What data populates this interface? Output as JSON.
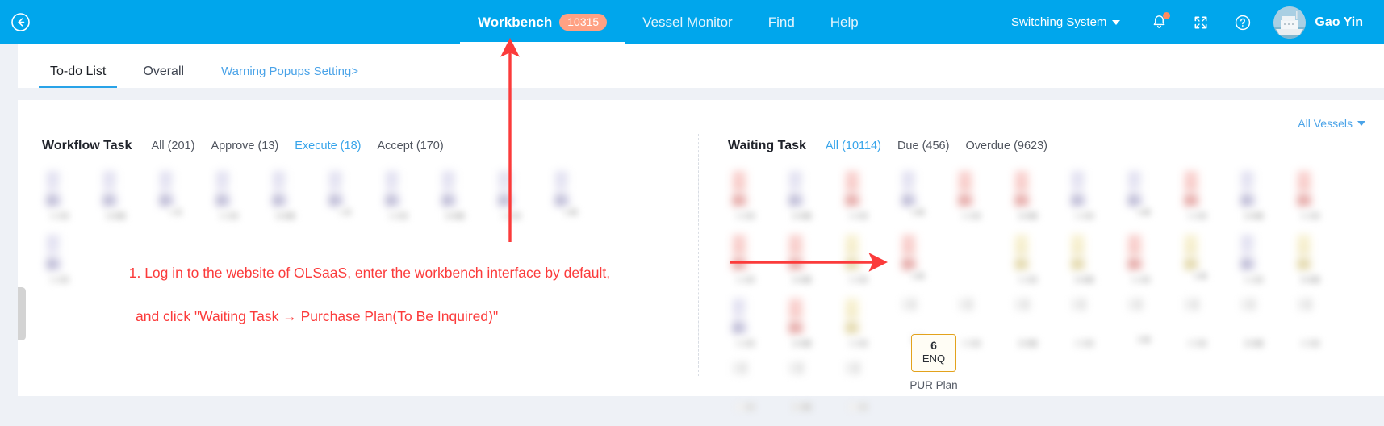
{
  "topbar": {
    "back_icon": "back-circle-icon",
    "nav_items": [
      {
        "label": "Workbench",
        "badge": "10315",
        "active": true
      },
      {
        "label": "Vessel Monitor",
        "active": false
      },
      {
        "label": "Find",
        "active": false
      },
      {
        "label": "Help",
        "active": false
      }
    ],
    "switching_system": "Switching System",
    "icons": [
      "bell-icon",
      "fullscreen-icon",
      "help-circle-icon"
    ],
    "user_name": "Gao Yin",
    "bg_color": "#00a6ec",
    "badge_color": "#ffa183"
  },
  "subtabs": [
    {
      "label": "To-do List",
      "active": true,
      "kind": "tab"
    },
    {
      "label": "Overall",
      "active": false,
      "kind": "tab"
    },
    {
      "label": "Warning Popups Setting>",
      "active": false,
      "kind": "link"
    }
  ],
  "content": {
    "vessel_filter": "All Vessels",
    "workflow": {
      "title": "Workflow Task",
      "filters": [
        {
          "label": "All (201)",
          "active": false
        },
        {
          "label": "Approve (13)",
          "active": false
        },
        {
          "label": "Execute (18)",
          "active": true
        },
        {
          "label": "Accept (170)",
          "active": false
        }
      ]
    },
    "waiting": {
      "title": "Waiting Task",
      "filters": [
        {
          "label": "All (10114)",
          "active": true
        },
        {
          "label": "Due (456)",
          "active": false
        },
        {
          "label": "Overdue (9623)",
          "active": false
        }
      ]
    },
    "highlighted_card": {
      "count": "6",
      "code": "ENQ",
      "label": "PUR Plan",
      "border_color": "#e3a21c"
    }
  },
  "annotation": {
    "line1": "1. Log in to the website of OLSaaS, enter the workbench interface by default,",
    "line2": "and click \"Waiting Task → Purchase Plan(To Be Inquired)\"",
    "color": "#fb3b3b"
  }
}
